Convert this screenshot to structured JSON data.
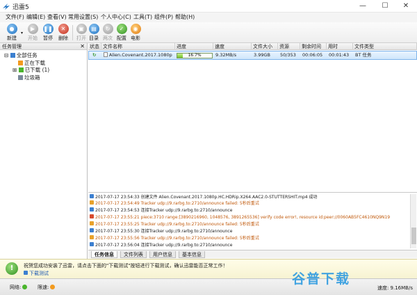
{
  "window": {
    "title": "迅雷5",
    "minimize": "—",
    "maximize": "☐",
    "close": "✕"
  },
  "menu": [
    "文件(F)",
    "编辑(E)",
    "查看(V)",
    "常用设置(S)",
    "个人中心(C)",
    "工具(T)",
    "组件(P)",
    "帮助(H)"
  ],
  "toolbar": [
    {
      "label": "新建",
      "icon": "new-icon",
      "enabled": true
    },
    {
      "label": "开始",
      "icon": "start-icon",
      "enabled": false
    },
    {
      "label": "暂停",
      "icon": "pause-icon",
      "enabled": true
    },
    {
      "label": "删除",
      "icon": "delete-icon",
      "enabled": true
    },
    {
      "label": "打开",
      "icon": "open-icon",
      "enabled": false
    },
    {
      "label": "目录",
      "icon": "folder-icon",
      "enabled": true
    },
    {
      "label": "两次",
      "icon": "repeat-icon",
      "enabled": false
    },
    {
      "label": "配置",
      "icon": "config-icon",
      "enabled": true
    },
    {
      "label": "电影",
      "icon": "movie-icon",
      "enabled": true
    }
  ],
  "left_panel": {
    "title": "任务管理",
    "close": "✕",
    "tree": [
      "全部任务",
      "正在下载",
      "已下载 (1)",
      "垃圾箱"
    ]
  },
  "grid": {
    "columns": [
      "状态",
      "文件名称",
      "进度",
      "速度",
      "文件大小",
      "资源",
      "剩余时间",
      "用时",
      "文件类型"
    ],
    "rows": [
      {
        "status": "↻",
        "name": "Alien.Covenant.2017.1080p",
        "progress_text": "16.7%",
        "progress": 0.167,
        "speed": "9.32MB/s",
        "size": "3.99GB",
        "sources": "50/353",
        "remaining": "00:06:05",
        "elapsed": "00:01:43",
        "type": "BT 任务"
      }
    ]
  },
  "log": [
    {
      "level": "info",
      "text": "2017-07-17 23:54:33 创建文件 Alien.Covenant.2017.1080p.HC.HDRip.X264.AAC2.0-STUTTERSHIT.mp4 成功"
    },
    {
      "level": "warn",
      "text": "2017-07-17 23:54:49 Tracker udp://9.rarbg.to:2710/announce failed: 5秒后重试"
    },
    {
      "level": "info",
      "text": "2017-07-17 23:54:53 连接Tracker udp://9.rarbg.to:2710/announce"
    },
    {
      "level": "err",
      "text": "2017-07-17 23:55:21 piece:3710 range:[3890216960, 1048576, 3891265536] verify code error!, resource id:peer://0060AB5FC4610NQ9N19"
    },
    {
      "level": "warn",
      "text": "2017-07-17 23:55:25 Tracker udp://9.rarbg.to:2710/announce failed: 5秒后重试"
    },
    {
      "level": "info",
      "text": "2017-07-17 23:55:30 连接Tracker udp://9.rarbg.to:2710/announce"
    },
    {
      "level": "warn",
      "text": "2017-07-17 23:55:56 Tracker udp://9.rarbg.to:2710/announce failed: 5秒后重试"
    },
    {
      "level": "info",
      "text": "2017-07-17 23:56:04 连接Tracker udp://9.rarbg.to:2710/announce"
    }
  ],
  "bottom_tabs": [
    "任务信息",
    "文件列表",
    "用户信息",
    "基本信息"
  ],
  "notice": {
    "text": "祝贺您成功安装了迅雷，请点击下面的\"下载测试\"按钮进行下载测试，确认迅雷能否正常工作！",
    "link": "下载测试"
  },
  "status": {
    "network": "网络:",
    "speed_limit": "限速:",
    "speed": "速度: 9.16MB/s"
  },
  "watermark": "谷普下载"
}
